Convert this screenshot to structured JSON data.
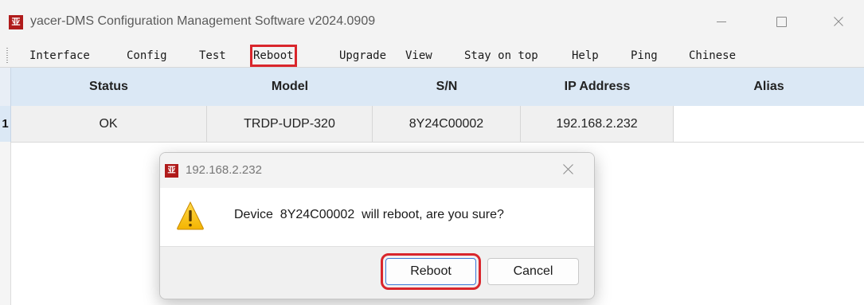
{
  "window": {
    "title": "yacer-DMS Configuration Management Software v2024.0909",
    "app_icon_glyph": "亚",
    "controls": [
      "minimize",
      "maximize",
      "close"
    ]
  },
  "menu": {
    "items": [
      {
        "label": "Interface"
      },
      {
        "label": "Config"
      },
      {
        "label": "Test"
      },
      {
        "label": "Reboot",
        "highlighted": true
      },
      {
        "label": "Upgrade"
      },
      {
        "label": "View"
      },
      {
        "label": "Stay on top"
      },
      {
        "label": "Help"
      },
      {
        "label": "Ping"
      },
      {
        "label": "Chinese"
      }
    ]
  },
  "table": {
    "columns": [
      "Status",
      "Model",
      "S/N",
      "IP Address",
      "Alias"
    ],
    "rows": [
      {
        "index": "1",
        "cells": [
          "OK",
          "TRDP-UDP-320",
          "8Y24C00002",
          "192.168.2.232",
          ""
        ]
      }
    ]
  },
  "dialog": {
    "title": "192.168.2.232",
    "icon_glyph": "亚",
    "message": "Device  8Y24C00002  will reboot, are you sure?",
    "icon": "warning-icon",
    "buttons": {
      "reboot": "Reboot",
      "cancel": "Cancel"
    }
  },
  "colors": {
    "highlight_outline": "#d9262c",
    "header_bg": "#dbe8f5",
    "brand_red": "#b01b1b",
    "focus_border": "#3c78d8"
  }
}
